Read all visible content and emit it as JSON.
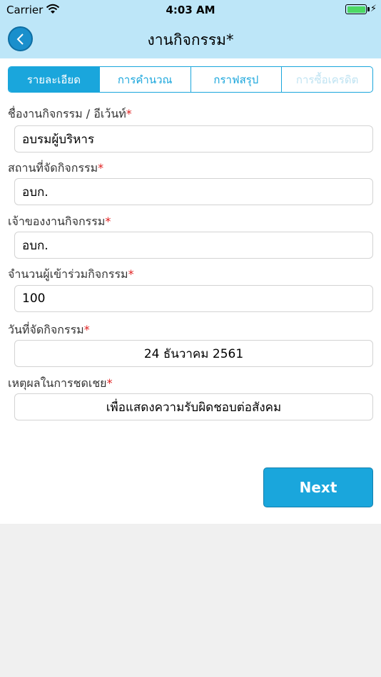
{
  "status_bar": {
    "carrier": "Carrier",
    "time": "4:03 AM"
  },
  "nav": {
    "title": "งานกิจกรรม*"
  },
  "tabs": [
    {
      "label": "รายละเอียด",
      "state": "active"
    },
    {
      "label": "การคำนวณ",
      "state": "normal"
    },
    {
      "label": "กราฟสรุป",
      "state": "normal"
    },
    {
      "label": "การซื้อเครดิต",
      "state": "disabled"
    }
  ],
  "form": {
    "event_name": {
      "label": "ชื่องานกิจกรรม / อีเว้นท์",
      "required": "*",
      "value": "อบรมผู้บริหาร"
    },
    "location": {
      "label": "สถานที่จัดกิจกรรม",
      "required": "*",
      "value": "อบก."
    },
    "owner": {
      "label": "เจ้าของงานกิจกรรม",
      "required": "*",
      "value": "อบก."
    },
    "participants": {
      "label": "จำนวนผู้เข้าร่วมกิจกรรม",
      "required": "*",
      "value": "100"
    },
    "date": {
      "label": "วันที่จัดกิจกรรม",
      "required": "*",
      "value": "24 ธันวาคม 2561"
    },
    "reason": {
      "label": "เหตุผลในการชดเชย",
      "required": "*",
      "value": "เพื่อแสดงความรับผิดชอบต่อสังคม"
    }
  },
  "next_button": {
    "label": "Next"
  },
  "colors": {
    "accent": "#1aa6dc",
    "header_bg": "#bde6f8",
    "required": "#e02020"
  }
}
